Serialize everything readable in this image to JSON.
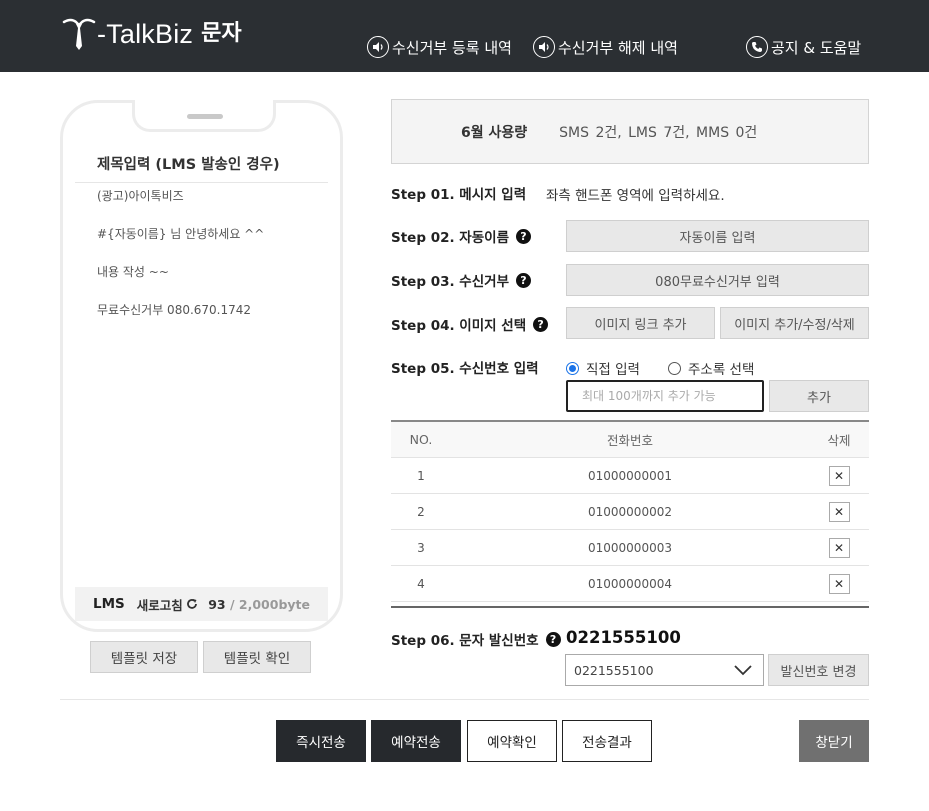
{
  "header": {
    "logo_text": "-TalkBiz",
    "logo_sub": "문자",
    "nav": [
      {
        "label": "수신거부 등록 내역",
        "icon": "speaker-icon"
      },
      {
        "label": "수신거부 해제 내역",
        "icon": "speaker-icon"
      },
      {
        "label": "공지 & 도움말",
        "icon": "phone-icon"
      }
    ]
  },
  "phone": {
    "title": "제목입력 (LMS 발송인 경우)",
    "lines": [
      "(광고)아이톡비즈",
      "#{자동이름} 님 안녕하세요 ^^",
      "내용 작성 ~~",
      "무료수신거부 080.670.1742"
    ],
    "type": "LMS",
    "refresh_label": "새로고침",
    "byte_count": "93",
    "byte_max": "/ 2,000byte"
  },
  "template_buttons": {
    "save": "템플릿 저장",
    "check": "템플릿 확인"
  },
  "usage": {
    "label": "6월 사용량",
    "values": "SMS 2건,  LMS 7건,  MMS 0건"
  },
  "steps": {
    "s1": {
      "label": "Step 01. 메시지 입력",
      "hint": "좌측 핸드폰 영역에 입력하세요."
    },
    "s2": {
      "label": "Step 02. 자동이름",
      "button": "자동이름 입력"
    },
    "s3": {
      "label": "Step 03. 수신거부",
      "button": "080무료수신거부 입력"
    },
    "s4": {
      "label": "Step 04. 이미지 선택",
      "button_link": "이미지 링크 추가",
      "button_edit": "이미지 추가/수정/삭제"
    },
    "s5": {
      "label": "Step 05. 수신번호 입력",
      "radio_direct": "직접 입력",
      "radio_book": "주소록 선택",
      "placeholder": "최대 100개까지 추가 가능",
      "add_button": "추가"
    },
    "s6": {
      "label": "Step 06. 문자 발신번호",
      "sender": "0221555100",
      "select_value": "0221555100",
      "change_button": "발신번호 변경"
    }
  },
  "table": {
    "headers": {
      "no": "NO.",
      "phone": "전화번호",
      "del": "삭제"
    },
    "rows": [
      {
        "no": "1",
        "phone": "01000000001"
      },
      {
        "no": "2",
        "phone": "01000000002"
      },
      {
        "no": "3",
        "phone": "01000000003"
      },
      {
        "no": "4",
        "phone": "01000000004"
      }
    ],
    "del_symbol": "✕"
  },
  "bottom": {
    "send_now": "즉시전송",
    "reserve": "예약전송",
    "reserve_check": "예약확인",
    "result": "전송결과",
    "close": "창닫기"
  },
  "colors": {
    "header_bg": "#2b2f33",
    "dark_button": "#26292d",
    "close_button": "#707070",
    "radio_accent": "#1a73e8"
  }
}
